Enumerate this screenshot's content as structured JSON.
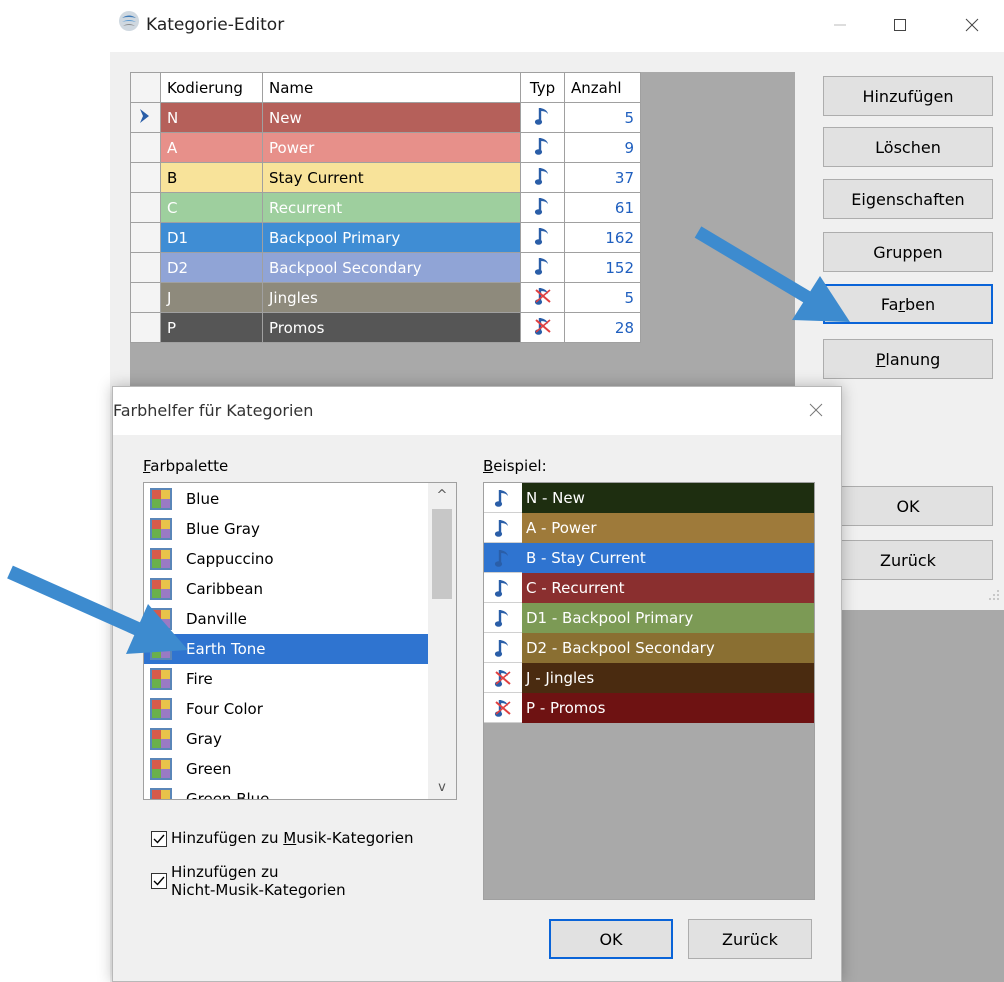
{
  "main_window": {
    "title": "Kategorie-Editor",
    "grid": {
      "columns": [
        "Kodierung",
        "Name",
        "Typ",
        "Anzahl"
      ],
      "rows": [
        {
          "code": "N",
          "name": "New",
          "type": "music",
          "count": "5",
          "color": "#b5605a",
          "text_color": "#ffffff"
        },
        {
          "code": "A",
          "name": "Power",
          "type": "music",
          "count": "9",
          "color": "#e7908a",
          "text_color": "#ffffff"
        },
        {
          "code": "B",
          "name": "Stay Current",
          "type": "music",
          "count": "37",
          "color": "#f8e39a",
          "text_color": "#000000"
        },
        {
          "code": "C",
          "name": "Recurrent",
          "type": "music",
          "count": "61",
          "color": "#9ecf9e",
          "text_color": "#ffffff"
        },
        {
          "code": "D1",
          "name": "Backpool Primary",
          "type": "music",
          "count": "162",
          "color": "#3f8dd4",
          "text_color": "#ffffff"
        },
        {
          "code": "D2",
          "name": "Backpool Secondary",
          "type": "music",
          "count": "152",
          "color": "#90a4d6",
          "text_color": "#ffffff"
        },
        {
          "code": "J",
          "name": "Jingles",
          "type": "non-music",
          "count": "5",
          "color": "#8e8a7c",
          "text_color": "#ffffff"
        },
        {
          "code": "P",
          "name": "Promos",
          "type": "non-music",
          "count": "28",
          "color": "#565656",
          "text_color": "#ffffff"
        }
      ]
    },
    "buttons": {
      "add": "Hinzufügen",
      "delete": "Löschen",
      "properties": "Eigenschaften",
      "groups": "Gruppen",
      "colors_pre": "Fa",
      "colors_key": "r",
      "colors_post": "ben",
      "planning_key": "P",
      "planning_post": "lanung",
      "ok": "OK",
      "back": "Zurück"
    }
  },
  "dialog": {
    "title": "Farbhelfer für Kategorien",
    "palette_label_key": "F",
    "palette_label_rest": "arbpalette",
    "example_label_key": "B",
    "example_label_rest": "eispiel:",
    "palettes": [
      {
        "name": "Blue"
      },
      {
        "name": "Blue Gray"
      },
      {
        "name": "Cappuccino"
      },
      {
        "name": "Caribbean"
      },
      {
        "name": "Danville"
      },
      {
        "name": "Earth Tone",
        "selected": true
      },
      {
        "name": "Fire"
      },
      {
        "name": "Four Color"
      },
      {
        "name": "Gray"
      },
      {
        "name": "Green"
      },
      {
        "name": "Green Blue"
      }
    ],
    "checkbox_music_pre": "Hinzufügen zu ",
    "checkbox_music_key": "M",
    "checkbox_music_post": "usik-Kategorien",
    "checkbox_music_checked": true,
    "checkbox_nonmusic_line1": "Hinzufügen zu",
    "checkbox_nonmusic_line2": "Nicht-Musik-Kategorien",
    "checkbox_nonmusic_checked": true,
    "example_rows": [
      {
        "label": "N - New",
        "type": "music",
        "color": "#1e2e10"
      },
      {
        "label": "A - Power",
        "type": "music",
        "color": "#9e7a3a"
      },
      {
        "label": "B - Stay Current",
        "type": "music",
        "color": "#2f74d0",
        "selected": true
      },
      {
        "label": "C - Recurrent",
        "type": "music",
        "color": "#8a2f2f"
      },
      {
        "label": "D1 - Backpool Primary",
        "type": "music",
        "color": "#7c9a55"
      },
      {
        "label": "D2 - Backpool Secondary",
        "type": "music",
        "color": "#8a6f32"
      },
      {
        "label": "J - Jingles",
        "type": "non-music",
        "color": "#4a2b10"
      },
      {
        "label": "P - Promos",
        "type": "non-music",
        "color": "#6e1212"
      }
    ],
    "ok": "OK",
    "back": "Zurück"
  },
  "colors": {
    "annotation_arrow": "#3d8bcf",
    "selection": "#2f74d0",
    "count_text": "#1f5fbf"
  }
}
